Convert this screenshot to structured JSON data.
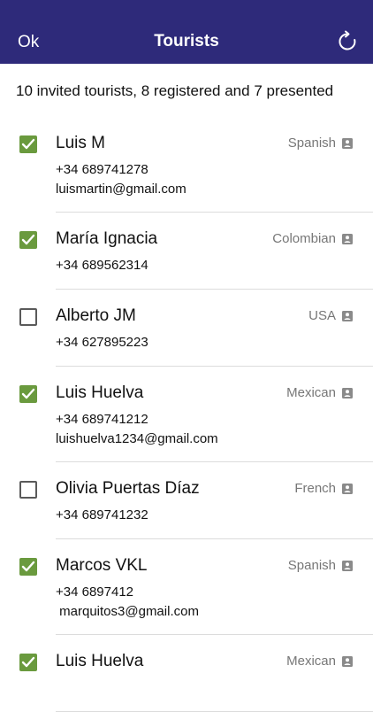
{
  "navbar": {
    "ok_label": "Ok",
    "title": "Tourists",
    "refresh_icon": "refresh-icon"
  },
  "summary": "10 invited tourists, 8 registered and 7 presented",
  "tourists": [
    {
      "name": "Luis M",
      "phone": "+34 689741278",
      "email": "luismartin@gmail.com",
      "nationality": "Spanish",
      "checked": true
    },
    {
      "name": "María Ignacia",
      "phone": "+34 689562314",
      "email": "",
      "nationality": "Colombian",
      "checked": true
    },
    {
      "name": "Alberto JM",
      "phone": "+34 627895223",
      "email": "",
      "nationality": "USA",
      "checked": false
    },
    {
      "name": "Luis Huelva",
      "phone": "+34 689741212",
      "email": "luishuelva1234@gmail.com",
      "nationality": "Mexican",
      "checked": true
    },
    {
      "name": "Olivia Puertas Díaz",
      "phone": "+34 689741232",
      "email": "",
      "nationality": "French",
      "checked": false
    },
    {
      "name": "Marcos VKL",
      "phone": "+34 6897412",
      "email": " marquitos3@gmail.com",
      "nationality": "Spanish",
      "checked": true
    },
    {
      "name": "Luis Huelva",
      "phone": "",
      "email": "",
      "nationality": "Mexican",
      "checked": true
    }
  ],
  "colors": {
    "navbar": "#2e2a7a",
    "checkbox_checked": "#6a9a3e",
    "nationality_text": "#777777"
  },
  "icons": {
    "checkbox_checked": "checkmark-icon",
    "nationality": "contact-card-icon"
  }
}
